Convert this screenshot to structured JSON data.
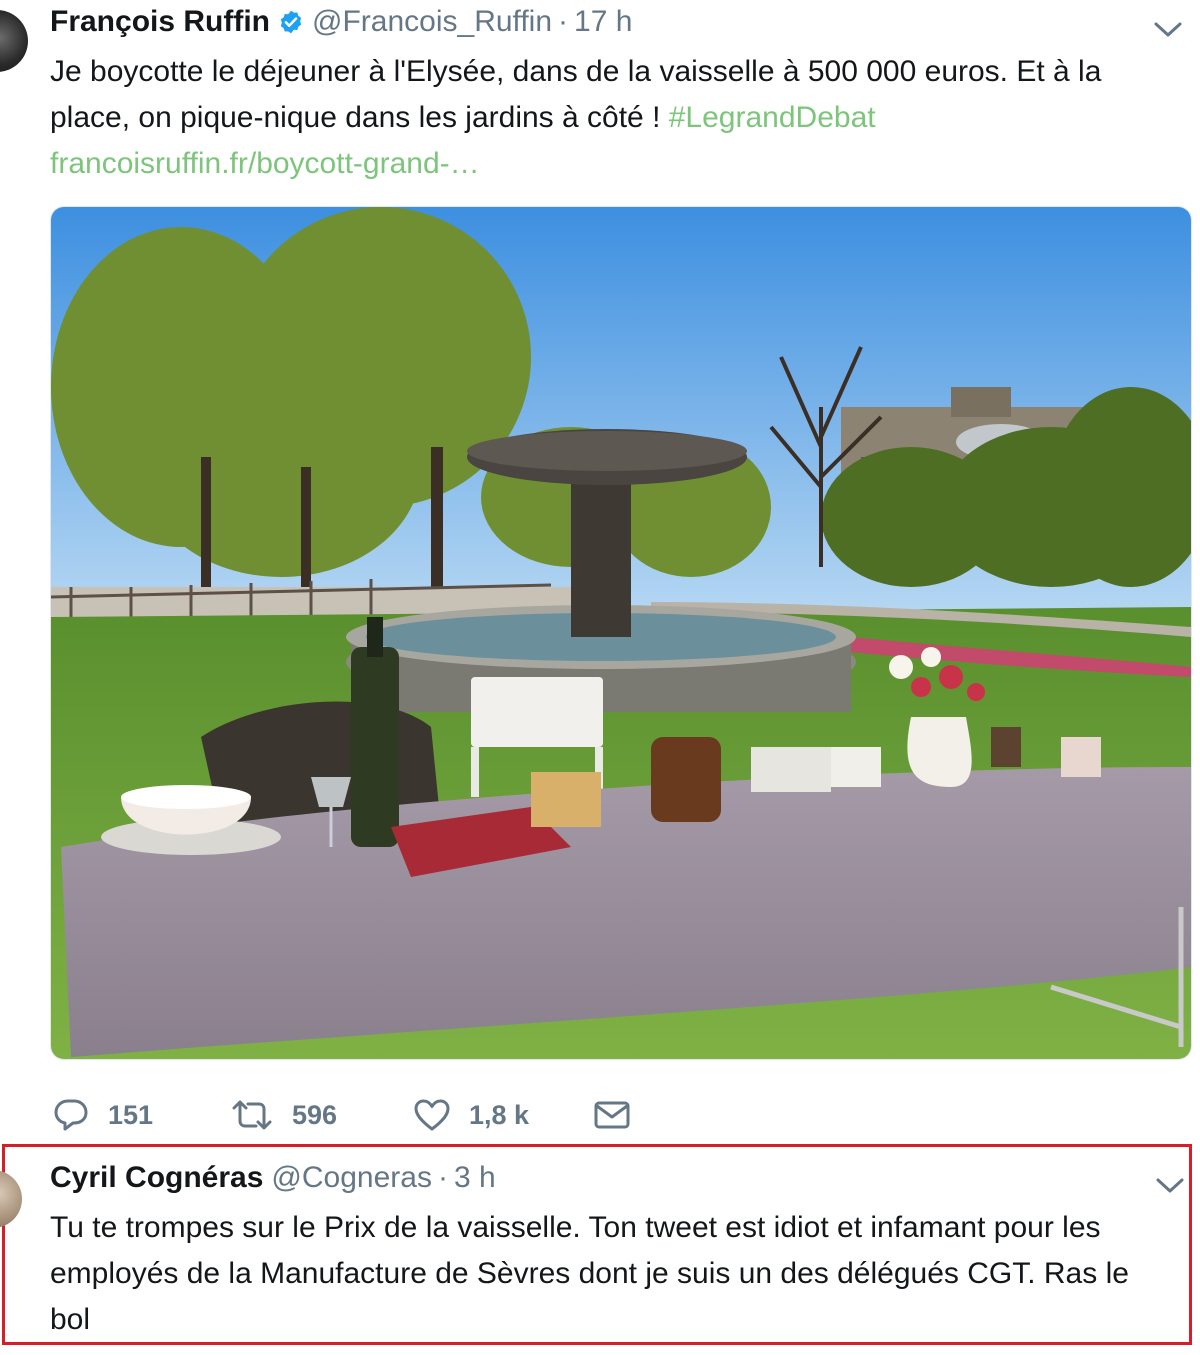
{
  "tweet": {
    "author_name": "François Ruffin",
    "verified": true,
    "handle": "@Francois_Ruffin",
    "separator": "·",
    "time": "17 h",
    "text_main": "Je boycotte le déjeuner à l'Elysée, dans de la vaisselle à 500 000 euros. Et à la place, on pique-nique dans les jardins à côté ! ",
    "hashtag": "#LegrandDebat",
    "link": "francoisruffin.fr/boycott-grand-…",
    "stats": {
      "replies": "151",
      "retweets": "596",
      "likes": "1,8 k"
    }
  },
  "reply": {
    "author_name": "Cyril Cognéras",
    "handle": "@Cogneras",
    "separator": "·",
    "time": "3 h",
    "text": "Tu te trompes sur le Prix de la vaisselle. Ton tweet est idiot et infamant pour les employés de la Manufacture de Sèvres dont je suis un des délégués CGT. Ras le bol"
  },
  "colors": {
    "link": "#7cc57b",
    "meta": "#657786",
    "highlight_border": "#d71d27",
    "verified": "#1da1f2"
  },
  "icons": [
    "reply-icon",
    "retweet-icon",
    "like-icon",
    "direct-message-icon",
    "chevron-down-icon",
    "verified-badge-icon"
  ]
}
